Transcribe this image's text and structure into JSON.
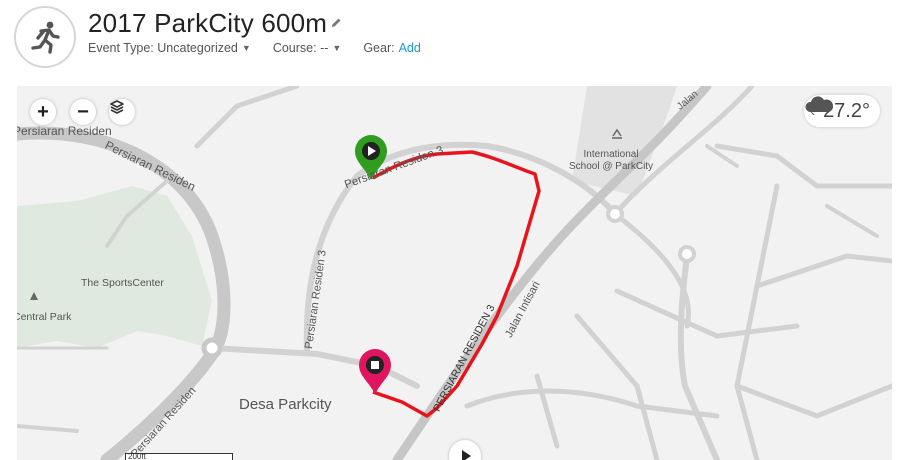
{
  "header": {
    "title": "2017 ParkCity 600m",
    "event_type_label": "Event Type:",
    "event_type_value": "Uncategorized",
    "course_label": "Course:",
    "course_value": "--",
    "gear_label": "Gear:",
    "gear_action": "Add"
  },
  "map": {
    "zoom_in": "+",
    "zoom_out": "−",
    "weather": {
      "temperature": "27.2°",
      "icon": "cloud-icon"
    },
    "scale_label": "200ft",
    "labels": {
      "persiaran_residen_top": "Persiaran Residen",
      "persiaran_residen_left": "Persiaran Residen",
      "persiaran_residen_3_top": "Persiaran Residen 3",
      "persiaran_residen_3_vertical": "Persiaran Residen 3",
      "persiaran_residen_3_diag": "PERSIARAN RESIDEN 3",
      "persiaran_residen_bottom": "Persiaran Residen",
      "jalan_intisari": "Jalan Intisari",
      "jalan_top": "Jalan",
      "school": "International\nSchool @ ParkCity",
      "sports_center": "The SportsCenter",
      "central_park": "Central Park",
      "desa_parkcity": "Desa Parkcity"
    },
    "colors": {
      "route": "#e8141c",
      "start_pin": "#2f9e1f",
      "end_pin": "#e0155f",
      "road": "#d2d2d2",
      "park": "#dfe9df"
    }
  }
}
